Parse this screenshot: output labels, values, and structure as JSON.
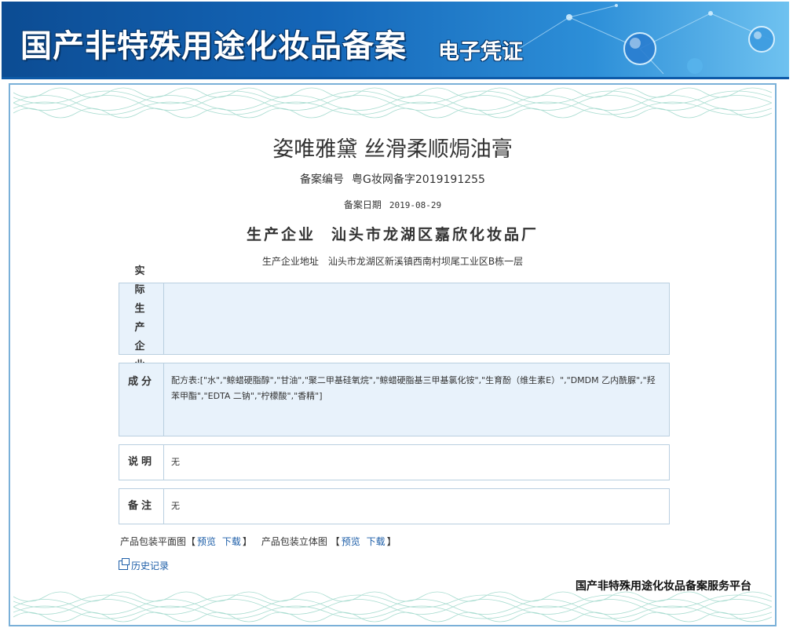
{
  "banner": {
    "title": "国产非特殊用途化妆品备案",
    "subtitle": "电子凭证"
  },
  "product": {
    "name": "姿唯雅黛 丝滑柔顺焗油膏",
    "reg_no_label": "备案编号",
    "reg_no": "粤G妆网备字2019191255",
    "date_label": "备案日期",
    "date": "2019-08-29",
    "company_label": "生产企业",
    "company": "汕头市龙湖区嘉欣化妆品厂",
    "address_label": "生产企业地址",
    "address": "汕头市龙湖区新溪镇西南村坝尾工业区B栋一层"
  },
  "sections": {
    "actual_producer": {
      "label": "实际生产企业",
      "value": ""
    },
    "ingredients": {
      "label": "成分",
      "value": "配方表:[\"水\",\"鲸蜡硬脂醇\",\"甘油\",\"聚二甲基硅氧烷\",\"鲸蜡硬脂基三甲基氯化铵\",\"生育酚（维生素E）\",\"DMDM 乙内酰脲\",\"羟苯甲酯\",\"EDTA 二钠\",\"柠檬酸\",\"香精\"]"
    },
    "description": {
      "label": "说明",
      "value": "无"
    },
    "remarks": {
      "label": "备注",
      "value": "无"
    }
  },
  "packaging": {
    "flat_label": "产品包装平面图",
    "solid_label": "产品包装立体图",
    "bracket_open": "【",
    "bracket_close": "】",
    "preview": "预览",
    "download": "下载"
  },
  "history_link": "历史记录",
  "footer_platform": "国产非特殊用途化妆品备案服务平台",
  "colors": {
    "banner_dark": "#0c4c93",
    "banner_light": "#6fc2f0",
    "box_fill": "#e8f2fb",
    "box_border": "#b9cfe0",
    "link": "#1d5ea8"
  }
}
